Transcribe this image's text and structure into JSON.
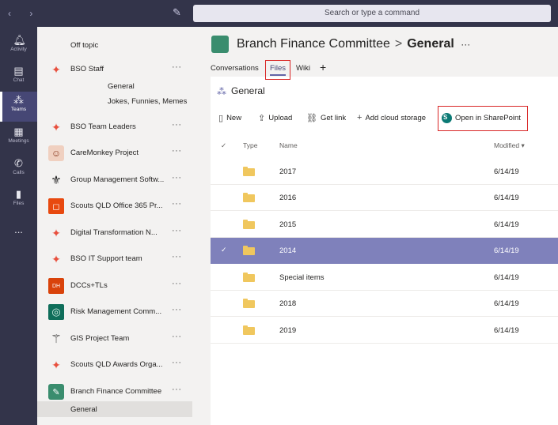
{
  "topbar": {
    "search_placeholder": "Search or type a command"
  },
  "rail": [
    {
      "label": "Activity",
      "icon": "bell-icon"
    },
    {
      "label": "Chat",
      "icon": "chat-icon"
    },
    {
      "label": "Teams",
      "icon": "teams-icon"
    },
    {
      "label": "Meetings",
      "icon": "calendar-icon"
    },
    {
      "label": "Calls",
      "icon": "phone-icon"
    },
    {
      "label": "Files",
      "icon": "file-icon"
    },
    {
      "label": "...",
      "icon": "more-icon"
    }
  ],
  "teams": [
    {
      "name": "Off topic",
      "logo": "",
      "color": "#f3f2f1"
    },
    {
      "name": "BSO Staff",
      "logo": "scout",
      "color": "#e84f3d"
    },
    {
      "name": "BSO Team Leaders",
      "logo": "scout",
      "color": "#e84f3d"
    },
    {
      "name": "CareMonkey Project",
      "logo": "monkey",
      "color": "#c85a3c"
    },
    {
      "name": "Group Management Softw...",
      "logo": "fleur",
      "color": "#222"
    },
    {
      "name": "Scouts QLD Office 365 Pr...",
      "logo": "office",
      "color": "#e8490f"
    },
    {
      "name": "Digital Transformation N...",
      "logo": "scout",
      "color": "#e84f3d"
    },
    {
      "name": "BSO IT Support team",
      "logo": "scout",
      "color": "#e84f3d"
    },
    {
      "name": "DCCs+TLs",
      "logo": "DH",
      "color": "#d9430b"
    },
    {
      "name": "Risk Management Comm...",
      "logo": "ring",
      "color": "#0f6e5a"
    },
    {
      "name": "GIS Project Team",
      "logo": "gis",
      "color": "#222"
    },
    {
      "name": "Scouts QLD Awards Orga...",
      "logo": "scout",
      "color": "#e84f3d"
    },
    {
      "name": "Branch Finance Committee",
      "logo": "fin",
      "color": "#3a8d6e"
    }
  ],
  "channels": {
    "bso_staff": [
      "General",
      "Jokes, Funnies, Memes"
    ],
    "branch_finance": [
      "General"
    ]
  },
  "header": {
    "team": "Branch Finance Committee",
    "channel": "General",
    "sep": ">",
    "more": "···"
  },
  "tabs": [
    {
      "label": "Conversations"
    },
    {
      "label": "Files"
    },
    {
      "label": "Wiki"
    },
    {
      "label": "+"
    }
  ],
  "files": {
    "title": "General",
    "commands": [
      {
        "label": "New",
        "icon": "new-file-icon"
      },
      {
        "label": "Upload",
        "icon": "upload-icon"
      },
      {
        "label": "Get link",
        "icon": "link-icon"
      },
      {
        "label": "Add cloud storage",
        "icon": "plus-icon"
      },
      {
        "label": "Open in SharePoint",
        "icon": "sharepoint-icon"
      }
    ],
    "columns": {
      "type": "Type",
      "name": "Name",
      "modified": "Modified ▾"
    },
    "rows": [
      {
        "name": "2017",
        "modified": "6/14/19",
        "selected": false
      },
      {
        "name": "2016",
        "modified": "6/14/19",
        "selected": false
      },
      {
        "name": "2015",
        "modified": "6/14/19",
        "selected": false
      },
      {
        "name": "2014",
        "modified": "6/14/19",
        "selected": true
      },
      {
        "name": "Special items",
        "modified": "6/14/19",
        "selected": false
      },
      {
        "name": "2018",
        "modified": "6/14/19",
        "selected": false
      },
      {
        "name": "2019",
        "modified": "6/14/19",
        "selected": false
      }
    ]
  }
}
